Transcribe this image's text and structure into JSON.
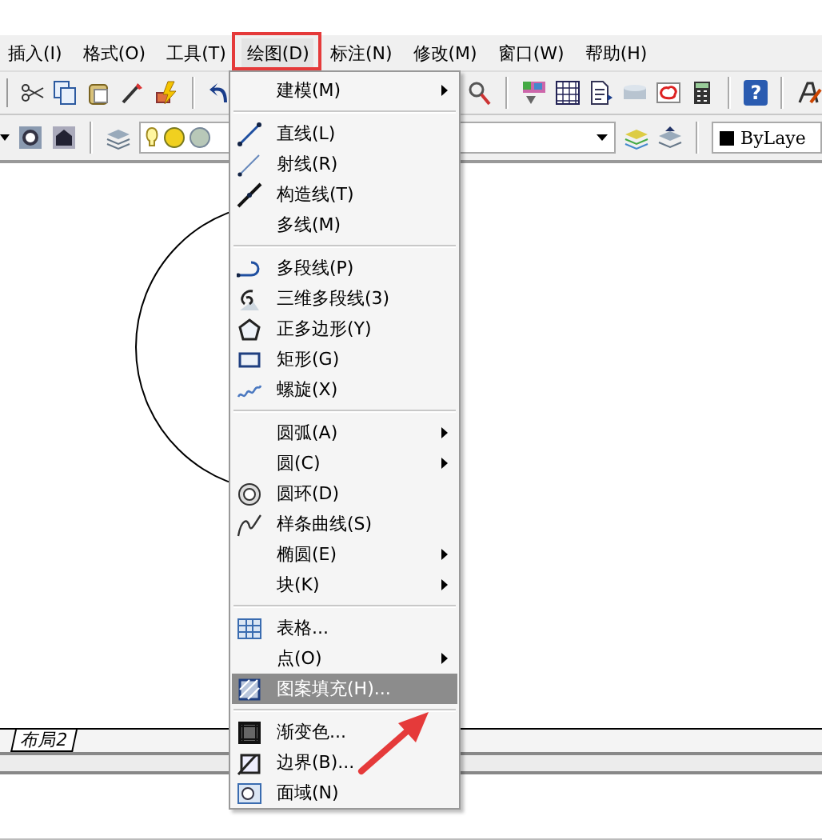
{
  "menubar": [
    {
      "label": "插入(I)",
      "selected": false
    },
    {
      "label": "格式(O)",
      "selected": false
    },
    {
      "label": "工具(T)",
      "selected": false
    },
    {
      "label": "绘图(D)",
      "selected": true
    },
    {
      "label": "标注(N)",
      "selected": false
    },
    {
      "label": "修改(M)",
      "selected": false
    },
    {
      "label": "窗口(W)",
      "selected": false
    },
    {
      "label": "帮助(H)",
      "selected": false
    }
  ],
  "toolbar": {
    "help": "?",
    "linetype": "ByLaye"
  },
  "layout_tabs": [
    {
      "label": "布局2"
    }
  ],
  "menu": [
    {
      "kind": "item",
      "label": "建模(M)",
      "submenu": true,
      "selected": false
    },
    {
      "kind": "separator"
    },
    {
      "kind": "item",
      "label": "直线(L)",
      "submenu": false,
      "selected": false
    },
    {
      "kind": "item",
      "label": "射线(R)",
      "submenu": false,
      "selected": false
    },
    {
      "kind": "item",
      "label": "构造线(T)",
      "submenu": false,
      "selected": false
    },
    {
      "kind": "item",
      "label": "多线(M)",
      "submenu": false,
      "selected": false
    },
    {
      "kind": "separator"
    },
    {
      "kind": "item",
      "label": "多段线(P)",
      "submenu": false,
      "selected": false
    },
    {
      "kind": "item",
      "label": "三维多段线(3)",
      "submenu": false,
      "selected": false
    },
    {
      "kind": "item",
      "label": "正多边形(Y)",
      "submenu": false,
      "selected": false
    },
    {
      "kind": "item",
      "label": "矩形(G)",
      "submenu": false,
      "selected": false
    },
    {
      "kind": "item",
      "label": "螺旋(X)",
      "submenu": false,
      "selected": false
    },
    {
      "kind": "separator"
    },
    {
      "kind": "item",
      "label": "圆弧(A)",
      "submenu": true,
      "selected": false
    },
    {
      "kind": "item",
      "label": "圆(C)",
      "submenu": true,
      "selected": false
    },
    {
      "kind": "item",
      "label": "圆环(D)",
      "submenu": false,
      "selected": false
    },
    {
      "kind": "item",
      "label": "样条曲线(S)",
      "submenu": false,
      "selected": false
    },
    {
      "kind": "item",
      "label": "椭圆(E)",
      "submenu": true,
      "selected": false
    },
    {
      "kind": "item",
      "label": "块(K)",
      "submenu": true,
      "selected": false
    },
    {
      "kind": "separator"
    },
    {
      "kind": "item",
      "label": "表格...",
      "submenu": false,
      "selected": false
    },
    {
      "kind": "item",
      "label": "点(O)",
      "submenu": true,
      "selected": false
    },
    {
      "kind": "item",
      "label": "图案填充(H)...",
      "submenu": false,
      "selected": true
    },
    {
      "kind": "separator"
    },
    {
      "kind": "item",
      "label": "渐变色...",
      "submenu": false,
      "selected": false
    },
    {
      "kind": "item",
      "label": "边界(B)...",
      "submenu": false,
      "selected": false
    },
    {
      "kind": "item",
      "label": "面域(N)",
      "submenu": false,
      "selected": false
    }
  ]
}
